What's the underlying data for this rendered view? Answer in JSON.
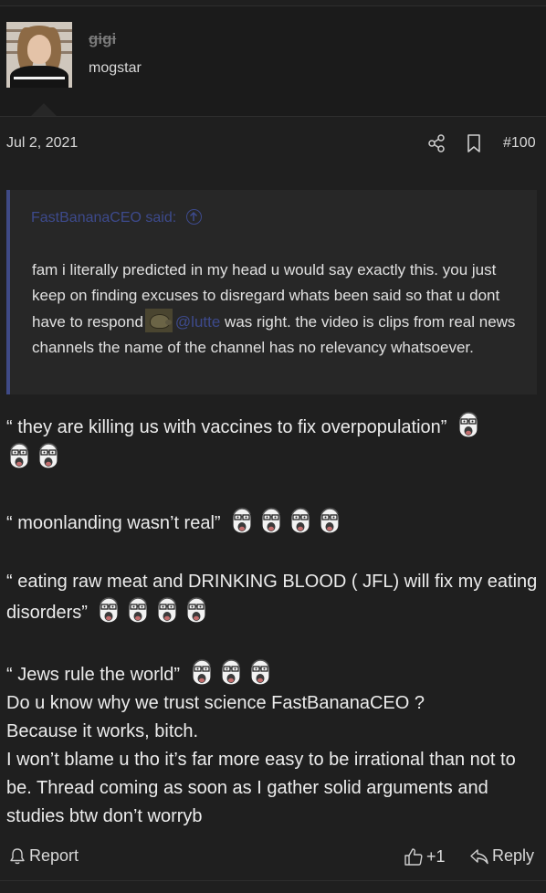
{
  "user": {
    "name": "gigi",
    "title": "mogstar"
  },
  "post_meta": {
    "date": "Jul 2, 2021",
    "post_number": "#100"
  },
  "quote": {
    "author_line": "FastBananaCEO said:",
    "text_part1": "fam i literally predicted in my head u would say exactly this. you just keep on finding excuses to disregard whats been said so that u dont have to respond",
    "mention": "@lutte",
    "text_part2": " was right. the video is clips from real news channels the name of the channel has no relevancy whatsoever."
  },
  "post": {
    "line1": "“ they are killing us with vaccines to fix overpopulation”",
    "line2": "“ moonlanding wasn’t real”",
    "line3": "“ eating raw meat and DRINKING BLOOD ( JFL) will fix my eating disorders”",
    "line4": "“ Jews rule the world”",
    "line5": "Do u know why we trust science FastBananaCEO ?",
    "line6": "Because it works, bitch.",
    "line7": "I won’t blame u tho it’s far more easy to be irrational than not to be. Thread coming as soon as I gather solid arguments and studies btw don’t worryb"
  },
  "footer": {
    "report_label": "Report",
    "like_label": "+1",
    "reply_label": "Reply"
  },
  "colors": {
    "background": "#1f1f1f",
    "quote_background": "#272727",
    "quote_accent": "#3f4a86",
    "link": "#3d4a8c"
  }
}
